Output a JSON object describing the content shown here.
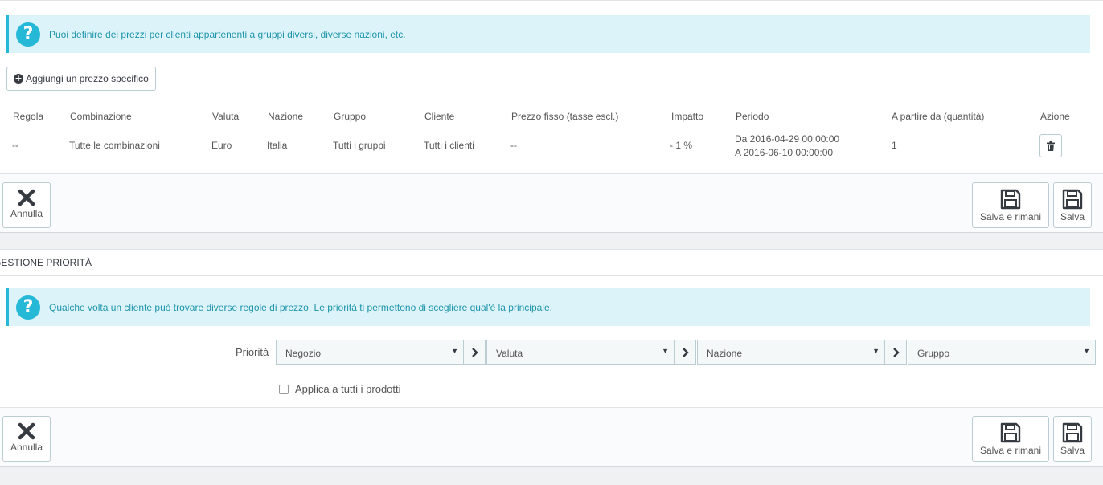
{
  "specific_prices": {
    "info": "Puoi definire dei prezzi per clienti appartenenti a gruppi diversi, diverse nazioni, etc.",
    "add_button": "Aggiungi un prezzo specifico",
    "columns": [
      "Regola",
      "Combinazione",
      "Valuta",
      "Nazione",
      "Gruppo",
      "Cliente",
      "Prezzo fisso (tasse escl.)",
      "Impatto",
      "Periodo",
      "A partire da (quantità)",
      "Azione"
    ],
    "row": {
      "regola": "--",
      "combinazione": "Tutte le combinazioni",
      "valuta": "Euro",
      "nazione": "Italia",
      "gruppo": "Tutti i gruppi",
      "cliente": "Tutti i clienti",
      "prezzo_fisso": "--",
      "impatto": "- 1 %",
      "periodo_da": "Da 2016-04-29 00:00:00",
      "periodo_a": "A 2016-06-10 00:00:00",
      "quantita": "1"
    }
  },
  "footer": {
    "cancel": "Annulla",
    "save_stay": "Salva e rimani",
    "save": "Salva"
  },
  "priority": {
    "title": "Gestione priorità",
    "info": "Qualche volta un cliente può trovare diverse regole di prezzo. Le priorità ti permettono di scegliere qual'è la principale.",
    "label": "Priorità",
    "selects": [
      "Negozio",
      "Valuta",
      "Nazione",
      "Gruppo"
    ],
    "apply_all": "Applica a tutti i prodotti"
  },
  "colors": {
    "info_bg": "#dcf4f9",
    "info_accent": "#25b9d7",
    "info_text": "#1e94ab"
  },
  "icons": [
    "question-icon",
    "plus-circle-icon",
    "trash-icon",
    "close-x-icon",
    "floppy-disk-icon",
    "chevron-right-icon",
    "caret-down-icon"
  ]
}
